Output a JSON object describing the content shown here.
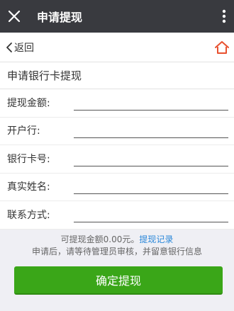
{
  "titlebar": {
    "title": "申请提现"
  },
  "nav": {
    "back_label": "返回"
  },
  "form": {
    "section_title": "申请银行卡提现",
    "fields": [
      {
        "label": "提现金额:",
        "value": ""
      },
      {
        "label": "开户行:",
        "value": ""
      },
      {
        "label": "银行卡号:",
        "value": ""
      },
      {
        "label": "真实姓名:",
        "value": ""
      },
      {
        "label": "联系方式:",
        "value": ""
      }
    ]
  },
  "footer": {
    "available_text": "可提现金额0.00元。",
    "records_link": "提现记录",
    "notice": "申请后，请等待管理员审核，并留意银行信息"
  },
  "confirm_button": "确定提现",
  "colors": {
    "titlebar": "#393a3f",
    "primary": "#3aa618",
    "link": "#2a87d9",
    "home_icon": "#e8512f"
  }
}
